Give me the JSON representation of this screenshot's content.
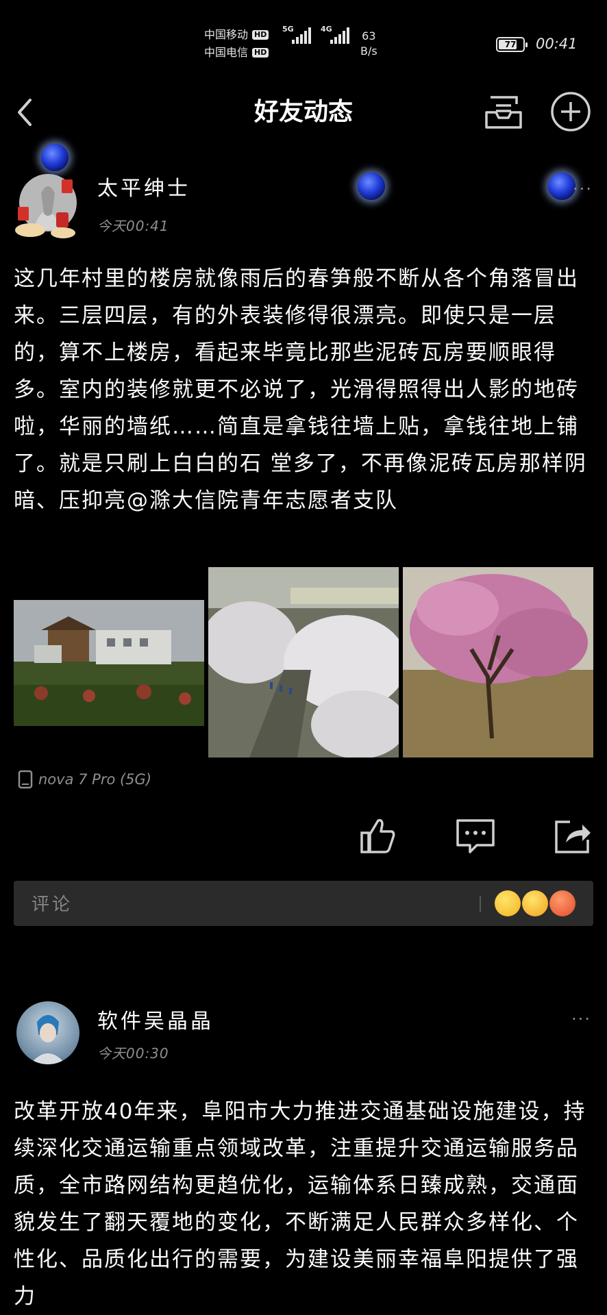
{
  "status_bar": {
    "carrier1": "中国移动",
    "carrier2": "中国电信",
    "hd": "HD",
    "net1": "5G",
    "net2": "4G",
    "speed_value": "63",
    "speed_unit": "B/s",
    "battery": "77",
    "battery_level": 0.77,
    "time": "00:41"
  },
  "header": {
    "title": "好友动态",
    "back_icon": "chevron-left-icon",
    "inbox_icon": "message-tray-icon",
    "add_icon": "plus-circle-icon"
  },
  "posts": [
    {
      "author": "太平绅士",
      "time": "今天00:41",
      "more": "···",
      "text": "这几年村里的楼房就像雨后的春笋般不断从各个角落冒出来。三层四层，有的外表装修得很漂亮。即使只是一层的，算不上楼房，看起来毕竟比那些泥砖瓦房要顺眼得多。室内的装修就更不必说了，光滑得照得出人影的地砖啦，华丽的墙纸……简直是拿钱往墙上贴，拿钱往地上铺了。就是只刷上白白的石 堂多了，不再像泥砖瓦房那样阴暗、压抑亮@滁大信院青年志愿者支队",
      "device": "nova 7 Pro (5G)",
      "actions": [
        "like-icon",
        "comment-icon",
        "share-icon"
      ],
      "comment_placeholder": "评论"
    },
    {
      "author": "软件吴晶晶",
      "time": "今天00:30",
      "more": "···",
      "text": " 改革开放40年来，阜阳市大力推进交通基础设施建设，持续深化交通运输重点领域改革，注重提升交通运输服务品质，全市路网结构更趋优化，运输体系日臻成熟，交通面貌发生了翻天覆地的变化，不断满足人民群众多样化、个性化、品质化出行的需要，为建设美丽幸福阜阳提供了强力"
    }
  ]
}
